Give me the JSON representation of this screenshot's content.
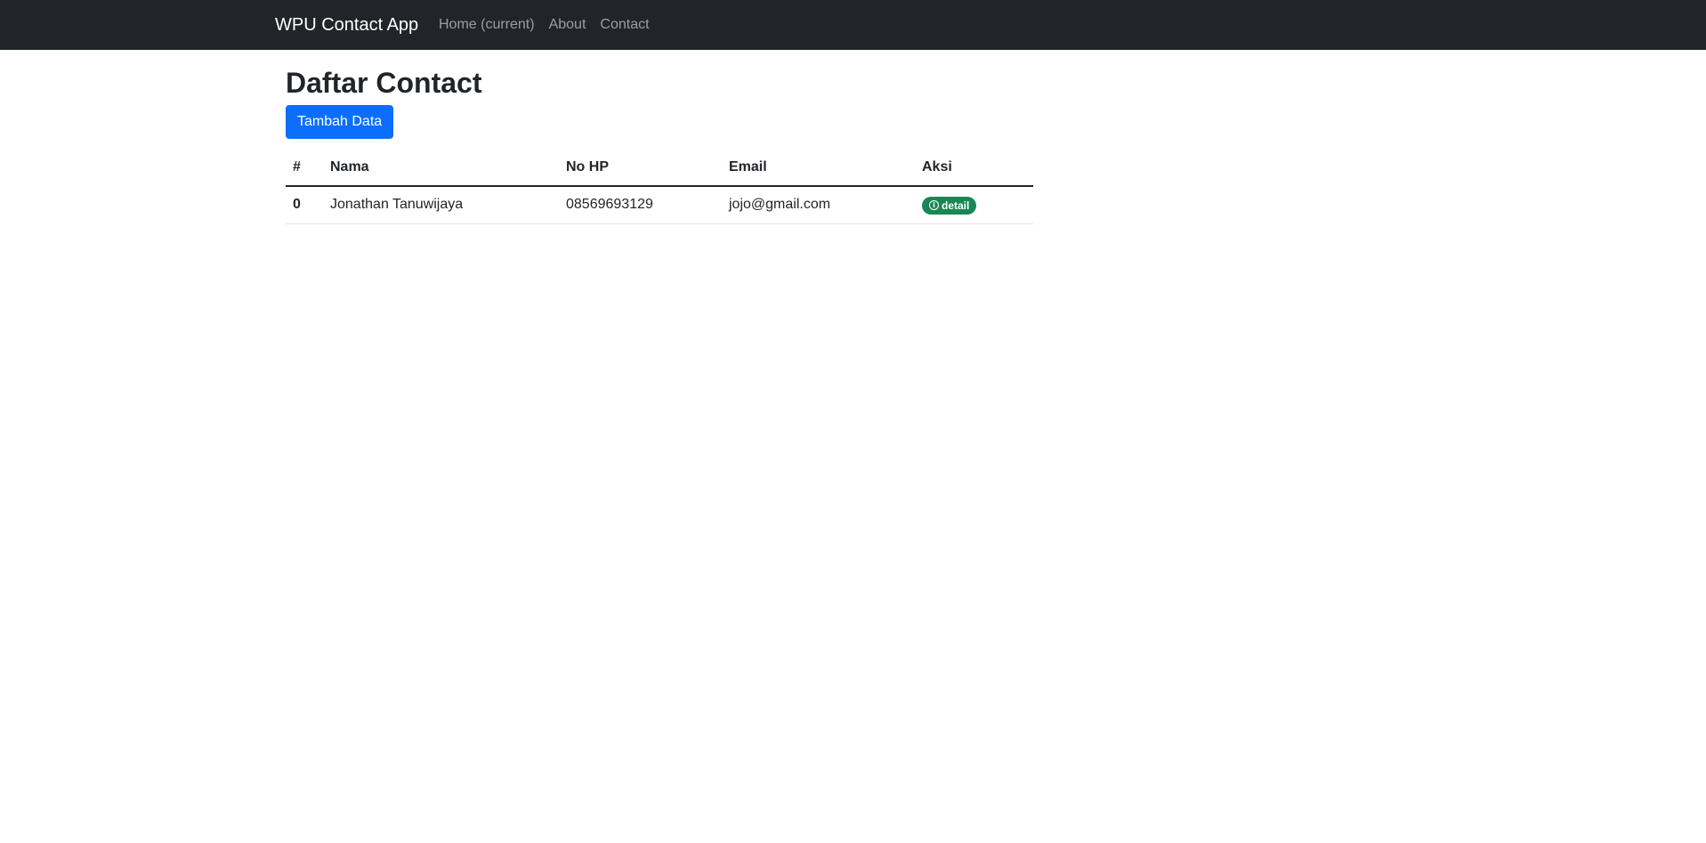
{
  "navbar": {
    "brand": "WPU Contact App",
    "links": [
      {
        "label": "Home (current)",
        "active": true
      },
      {
        "label": "About",
        "active": false
      },
      {
        "label": "Contact",
        "active": false
      }
    ]
  },
  "main": {
    "title": "Daftar Contact",
    "add_button": "Tambah Data",
    "table": {
      "headers": [
        "#",
        "Nama",
        "No HP",
        "Email",
        "Aksi"
      ],
      "rows": [
        {
          "index": "0",
          "nama": "Jonathan Tanuwijaya",
          "nohp": "08569693129",
          "email": "jojo@gmail.com",
          "action_label": "detail",
          "action_icon": "info-icon"
        }
      ]
    }
  },
  "colors": {
    "navbar_bg": "#212529",
    "primary": "#0d6efd",
    "success": "#198754"
  }
}
